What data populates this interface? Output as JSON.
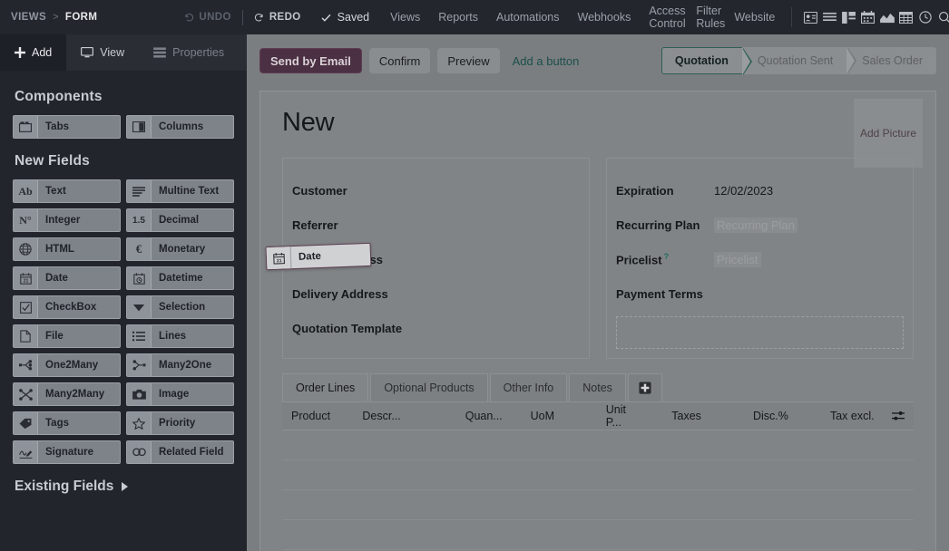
{
  "topbar": {
    "breadcrumb": {
      "root": "VIEWS",
      "sep": ">",
      "current": "FORM"
    },
    "undo_label": "UNDO",
    "redo_label": "REDO",
    "saved_label": "Saved",
    "navlinks": [
      "Views",
      "Reports",
      "Automations",
      "Webhooks",
      "Access Control",
      "Filter Rules",
      "Website"
    ],
    "icons": [
      "contact-card-icon",
      "list-view-icon",
      "kanban-view-icon",
      "calendar-view-icon",
      "graph-view-icon",
      "pivot-view-icon",
      "activity-view-icon",
      "search-icon"
    ]
  },
  "sidebar": {
    "tabs": [
      {
        "label": "Add",
        "icon": "plus-icon",
        "active": true
      },
      {
        "label": "View",
        "icon": "screen-icon",
        "active": false
      },
      {
        "label": "Properties",
        "icon": "properties-icon",
        "active": false
      }
    ],
    "components_title": "Components",
    "components": [
      {
        "label": "Tabs",
        "icon": "tabs-icon"
      },
      {
        "label": "Columns",
        "icon": "columns-icon"
      }
    ],
    "new_fields_title": "New Fields",
    "new_fields": [
      {
        "label": "Text",
        "icon": "ab-icon",
        "glyph": "Ab"
      },
      {
        "label": "Multine Text",
        "icon": "multiline-text-icon",
        "glyph": ""
      },
      {
        "label": "Integer",
        "icon": "integer-icon",
        "glyph": "N°"
      },
      {
        "label": "Decimal",
        "icon": "decimal-icon",
        "glyph": "1.5"
      },
      {
        "label": "HTML",
        "icon": "globe-icon",
        "glyph": ""
      },
      {
        "label": "Monetary",
        "icon": "euro-icon",
        "glyph": "€"
      },
      {
        "label": "Date",
        "icon": "calendar-icon",
        "glyph": ""
      },
      {
        "label": "Datetime",
        "icon": "clock-calendar-icon",
        "glyph": ""
      },
      {
        "label": "CheckBox",
        "icon": "checkbox-icon",
        "glyph": ""
      },
      {
        "label": "Selection",
        "icon": "caret-down-icon",
        "glyph": ""
      },
      {
        "label": "File",
        "icon": "file-icon",
        "glyph": ""
      },
      {
        "label": "Lines",
        "icon": "lines-icon",
        "glyph": ""
      },
      {
        "label": "One2Many",
        "icon": "one2many-icon",
        "glyph": ""
      },
      {
        "label": "Many2One",
        "icon": "many2one-icon",
        "glyph": ""
      },
      {
        "label": "Many2Many",
        "icon": "many2many-icon",
        "glyph": ""
      },
      {
        "label": "Image",
        "icon": "camera-icon",
        "glyph": ""
      },
      {
        "label": "Tags",
        "icon": "tag-icon",
        "glyph": ""
      },
      {
        "label": "Priority",
        "icon": "star-icon",
        "glyph": ""
      },
      {
        "label": "Signature",
        "icon": "signature-icon",
        "glyph": ""
      },
      {
        "label": "Related Field",
        "icon": "link-icon",
        "glyph": ""
      }
    ],
    "existing_fields_title": "Existing Fields"
  },
  "main": {
    "buttons": [
      {
        "label": "Send by Email",
        "style": "primary"
      },
      {
        "label": "Confirm",
        "style": "secondary"
      },
      {
        "label": "Preview",
        "style": "secondary"
      },
      {
        "label": "Add a button",
        "style": "link"
      }
    ],
    "status_steps": [
      {
        "label": "Quotation",
        "active": true
      },
      {
        "label": "Quotation Sent",
        "active": false
      },
      {
        "label": "Sales Order",
        "active": false
      }
    ],
    "record_title": "New",
    "add_picture_label": "Add Picture",
    "left_fields": [
      {
        "label": "Customer",
        "value": ""
      },
      {
        "label": "Referrer",
        "value": ""
      },
      {
        "label": "Invoice Address",
        "value": ""
      },
      {
        "label": "Delivery Address",
        "value": ""
      },
      {
        "label": "Quotation Template",
        "value": ""
      }
    ],
    "right_fields": [
      {
        "label": "Expiration",
        "value": "12/02/2023",
        "placeholder": false,
        "help": false
      },
      {
        "label": "Recurring Plan",
        "value": "Recurring Plan",
        "placeholder": true,
        "help": false
      },
      {
        "label": "Pricelist",
        "value": "Pricelist",
        "placeholder": true,
        "help": true
      },
      {
        "label": "Payment Terms",
        "value": "",
        "placeholder": false,
        "help": false
      }
    ],
    "drag_chip": {
      "label": "Date",
      "icon": "calendar-icon"
    },
    "notebook_tabs": [
      {
        "label": "Order Lines",
        "active": true
      },
      {
        "label": "Optional Products",
        "active": false
      },
      {
        "label": "Other Info",
        "active": false
      },
      {
        "label": "Notes",
        "active": false
      }
    ],
    "notebook_add_icon": "plus-square-icon",
    "table_headers": [
      "Product",
      "Descr...",
      "Quan...",
      "UoM",
      "Unit P...",
      "Taxes",
      "Disc.%",
      "Tax excl."
    ],
    "table_settings_icon": "column-settings-icon",
    "table_rows": 4
  },
  "colors": {
    "topbar_bg": "#23262c",
    "sidebar_bg": "#22252b",
    "accent_primary": "#4b2f42",
    "accent_link": "#1b4f4c",
    "overlay_gray": "#7b7e80",
    "drag_border": "#5d3d52"
  }
}
